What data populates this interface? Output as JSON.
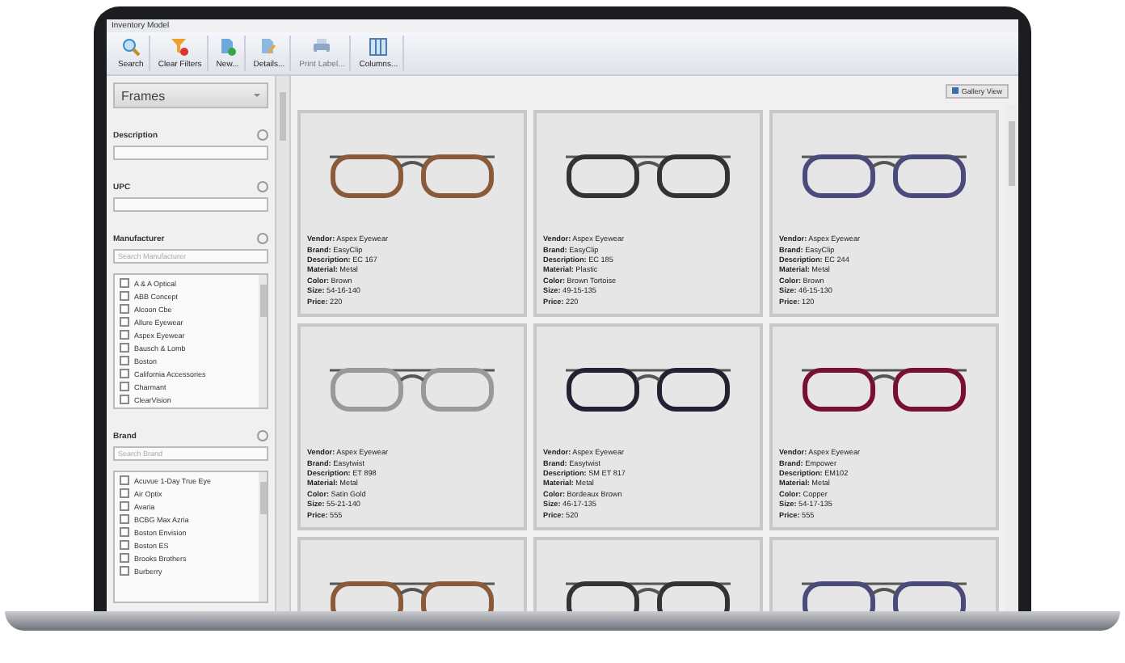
{
  "window": {
    "title": "Inventory Model"
  },
  "toolbar": [
    {
      "kind": "search",
      "label": "Search",
      "disabled": false
    },
    {
      "kind": "clear",
      "label": "Clear Filters",
      "disabled": false
    },
    {
      "kind": "new",
      "label": "New...",
      "disabled": false
    },
    {
      "kind": "details",
      "label": "Details...",
      "disabled": false
    },
    {
      "kind": "print",
      "label": "Print Label...",
      "disabled": true
    },
    {
      "kind": "columns",
      "label": "Columns...",
      "disabled": false
    }
  ],
  "sidebar": {
    "category": "Frames",
    "description": {
      "label": "Description"
    },
    "upc": {
      "label": "UPC"
    },
    "manufacturer": {
      "label": "Manufacturer",
      "placeholder": "Search Manufacturer",
      "items": [
        {
          "label": "A & A Optical",
          "checked": false
        },
        {
          "label": "ABB Concept",
          "checked": false
        },
        {
          "label": "Alcoon Cbe",
          "checked": false
        },
        {
          "label": "Allure Eyewear",
          "checked": false
        },
        {
          "label": "Aspex Eyewear",
          "checked": false
        },
        {
          "label": "Bausch & Lomb",
          "checked": false
        },
        {
          "label": "Boston",
          "checked": false
        },
        {
          "label": "California Accessories",
          "checked": false
        },
        {
          "label": "Charmant",
          "checked": false
        },
        {
          "label": "ClearVision",
          "checked": false
        }
      ]
    },
    "brand": {
      "label": "Brand",
      "placeholder": "Search Brand",
      "items": [
        {
          "label": "Acuvue 1-Day True Eye",
          "checked": false
        },
        {
          "label": "Air Optix",
          "checked": false
        },
        {
          "label": "Avaria",
          "checked": false
        },
        {
          "label": "BCBG Max Azria",
          "checked": false
        },
        {
          "label": "Boston Envision",
          "checked": false
        },
        {
          "label": "Boston ES",
          "checked": false
        },
        {
          "label": "Brooks Brothers",
          "checked": false
        },
        {
          "label": "Burberry",
          "checked": false
        }
      ]
    }
  },
  "view": {
    "label": "Gallery View"
  },
  "cards": [
    {
      "kind": "details",
      "lines": [
        "**Vendor:** Aspex Eyewear",
        "**Brand:** EasyClip",
        "**Description:** EC 167",
        "**Material:** Metal",
        "**Color:** Brown",
        "**Size:** 54-16-140",
        "**Price:** 220"
      ]
    },
    {
      "kind": "details",
      "lines": [
        "**Vendor:** Aspex Eyewear",
        "**Brand:** EasyClip",
        "**Description:** EC 185",
        "**Material:** Plastic",
        "**Color:** Brown Tortoise",
        "**Size:** 49-15-135",
        "**Price:** 220"
      ]
    },
    {
      "kind": "details",
      "lines": [
        "**Vendor:** Aspex Eyewear",
        "**Brand:** EasyClip",
        "**Description:** EC 244",
        "**Material:** Metal",
        "**Color:** Brown",
        "**Size:** 46-15-130",
        "**Price:** 120"
      ]
    },
    {
      "kind": "details",
      "lines": [
        "**Vendor:** Aspex Eyewear",
        "**Brand:** Easytwist",
        "**Description:** ET 898",
        "**Material:** Metal",
        "**Color:** Satin Gold",
        "**Size:** 55-21-140",
        "**Price:** 555"
      ]
    },
    {
      "kind": "details",
      "lines": [
        "**Vendor:** Aspex Eyewear",
        "**Brand:** Easytwist",
        "**Description:** SM ET 817",
        "**Material:** Metal",
        "**Color:** Bordeaux Brown",
        "**Size:** 46-17-135",
        "**Price:** 520"
      ]
    },
    {
      "kind": "details",
      "lines": [
        "**Vendor:** Aspex Eyewear",
        "**Brand:** Empower",
        "**Description:** EM102",
        "**Material:** Metal",
        "**Color:** Copper",
        "**Size:** 54-17-135",
        "**Price:** 555"
      ]
    },
    {
      "kind": "photo"
    },
    {
      "kind": "photo"
    },
    {
      "kind": "photo"
    }
  ]
}
